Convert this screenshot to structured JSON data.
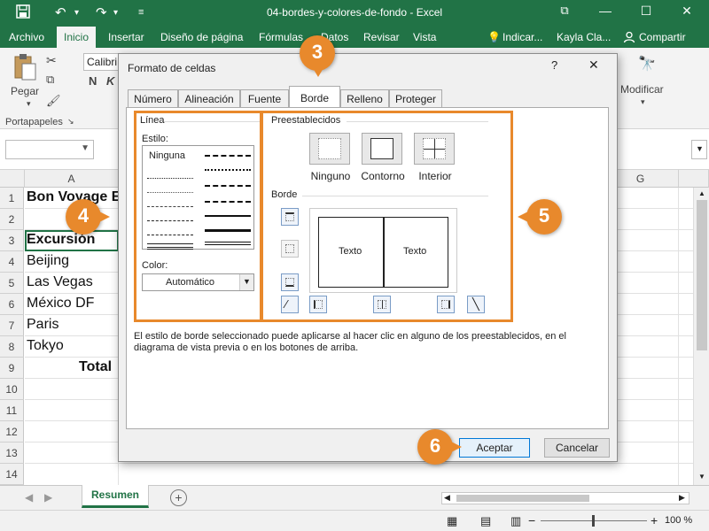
{
  "window": {
    "title": "04-bordes-y-colores-de-fondo  -  Excel",
    "minimize": "—",
    "restore": "☐",
    "close": "✕"
  },
  "quick_access": {
    "save_icon": "save-icon",
    "undo_icon": "undo-icon",
    "redo_icon": "redo-icon"
  },
  "ribbon_tabs": [
    {
      "label": "Archivo"
    },
    {
      "label": "Inicio"
    },
    {
      "label": "Insertar"
    },
    {
      "label": "Diseño de página"
    },
    {
      "label": "Fórmulas"
    },
    {
      "label": "Datos"
    },
    {
      "label": "Revisar"
    },
    {
      "label": "Vista"
    }
  ],
  "ribbon_right": {
    "tell_me": "Indicar...",
    "user": "Kayla Cla...",
    "share": "Compartir"
  },
  "ribbon": {
    "paste_label": "Pegar",
    "clipboard_group": "Portapapeles",
    "font_name": "Calibri",
    "bold": "N",
    "italic": "K",
    "modify_label": "Modificar"
  },
  "grid": {
    "columns": [
      "A",
      "G"
    ],
    "rows": [
      "1",
      "2",
      "3",
      "4",
      "5",
      "6",
      "7",
      "8",
      "9",
      "10",
      "11",
      "12",
      "13",
      "14"
    ],
    "cells": [
      {
        "row": "1",
        "text": "Bon Voyage E"
      },
      {
        "row": "3",
        "text": "Excursión"
      },
      {
        "row": "4",
        "text": "Beijing"
      },
      {
        "row": "5",
        "text": "Las Vegas"
      },
      {
        "row": "6",
        "text": "México DF"
      },
      {
        "row": "7",
        "text": "Paris"
      },
      {
        "row": "8",
        "text": "Tokyo"
      },
      {
        "row": "9",
        "text": "Total"
      }
    ]
  },
  "sheet_tabs": {
    "active": "Resumen",
    "add": "+"
  },
  "status": {
    "zoom": "100 %"
  },
  "dialog": {
    "title": "Formato de celdas",
    "help": "?",
    "close": "✕",
    "tabs": [
      {
        "label": "Número"
      },
      {
        "label": "Alineación"
      },
      {
        "label": "Fuente"
      },
      {
        "label": "Borde"
      },
      {
        "label": "Relleno"
      },
      {
        "label": "Proteger"
      }
    ],
    "line_group": "Línea",
    "style_label": "Estilo:",
    "style_none": "Ninguna",
    "color_label": "Color:",
    "color_value": "Automático",
    "presets_group": "Preestablecidos",
    "presets": [
      {
        "label": "Ninguno"
      },
      {
        "label": "Contorno"
      },
      {
        "label": "Interior"
      }
    ],
    "border_group": "Borde",
    "preview_text_left": "Texto",
    "preview_text_right": "Texto",
    "hint": "El estilo de borde seleccionado puede aplicarse al hacer clic en alguno de los preestablecidos, en el diagrama de vista previa o en los botones de arriba.",
    "ok": "Aceptar",
    "cancel": "Cancelar"
  },
  "annotations": [
    {
      "number": "3"
    },
    {
      "number": "4"
    },
    {
      "number": "5"
    },
    {
      "number": "6"
    }
  ],
  "colors": {
    "excel_green": "#217346",
    "accent_orange": "#e8892c"
  }
}
